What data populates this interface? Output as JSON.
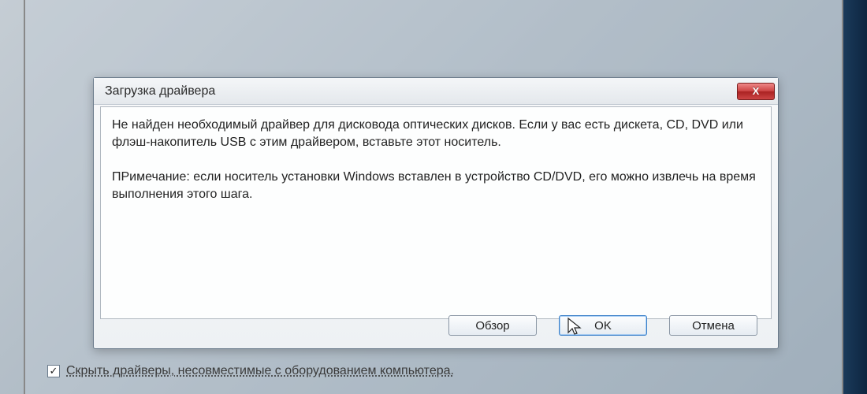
{
  "dialog": {
    "title": "Загрузка драйвера",
    "close_x": "X",
    "message_line1": "Не найден необходимый драйвер для дисковода оптических дисков. Если у вас есть дискета, CD, DVD или флэш-накопитель USB с этим драйвером, вставьте этот носитель.",
    "message_line2": "ПРимечание: если носитель установки Windows вставлен в устройство CD/DVD, его можно извлечь на время выполнения этого шага.",
    "buttons": {
      "browse": "Обзор",
      "ok": "OK",
      "cancel": "Отмена"
    }
  },
  "parent": {
    "hide_incompatible_label": "Скрыть драйверы, несовместимые с оборудованием компьютера.",
    "hide_incompatible_checked": "✓"
  }
}
